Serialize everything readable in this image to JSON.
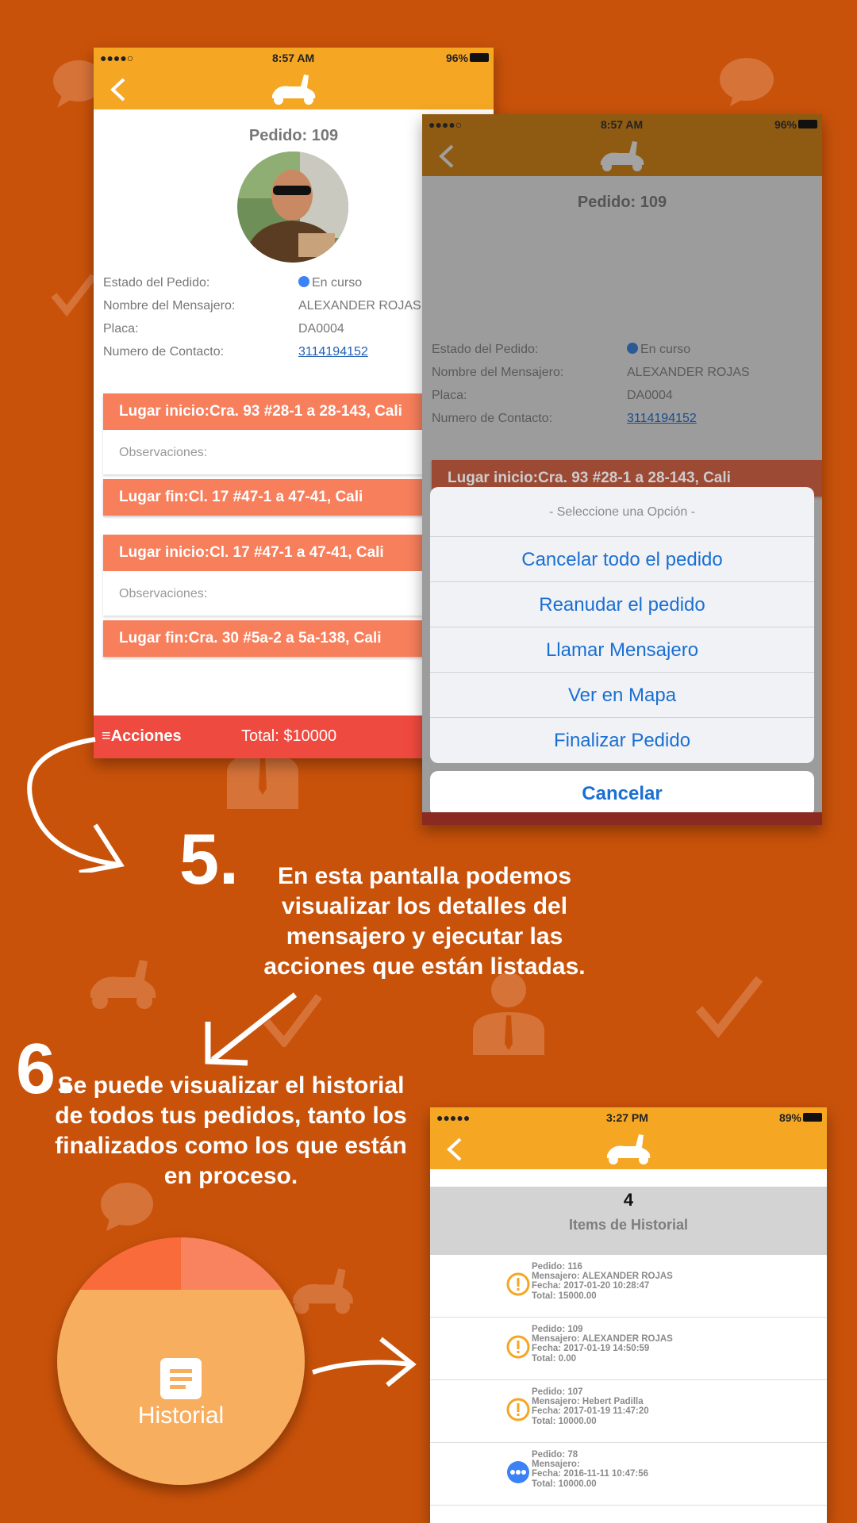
{
  "colors": {
    "background": "#c9520a",
    "accent": "#f5a623",
    "bar": "#f77f5c",
    "footer": "#ef4a3f",
    "actionBlue": "#1a6fd4",
    "historyCircle": "#f8ae5f"
  },
  "phone1": {
    "status": {
      "carrier": "●●●●○",
      "time": "8:57 AM",
      "battery": "96%"
    },
    "order_title": "Pedido: 109",
    "info": [
      {
        "key": "Estado del Pedido:",
        "value": "En curso"
      },
      {
        "key": "Nombre del Mensajero:",
        "value": "ALEXANDER ROJAS"
      },
      {
        "key": "Placa:",
        "value": "DA0004"
      },
      {
        "key": "Numero de Contacto:",
        "value": "3114194152"
      }
    ],
    "route1": {
      "start": "Lugar inicio:Cra. 93 #28-1 a 28-143, Cali",
      "obs": "Observaciones:",
      "end": "Lugar fin:Cl. 17 #47-1 a 47-41, Cali"
    },
    "route2": {
      "start": "Lugar inicio:Cl. 17 #47-1 a 47-41, Cali",
      "obs": "Observaciones:",
      "end": "Lugar fin:Cra. 30 #5a-2 a 5a-138, Cali"
    },
    "footer": {
      "actions": "≡Acciones",
      "total": "Total: $10000"
    }
  },
  "phone2": {
    "status": {
      "carrier": "●●●●○",
      "time": "8:57 AM",
      "battery": "96%"
    },
    "order_title": "Pedido: 109",
    "info": [
      {
        "key": "Estado del Pedido:",
        "value": "En curso"
      },
      {
        "key": "Nombre del Mensajero:",
        "value": "ALEXANDER ROJAS"
      },
      {
        "key": "Placa:",
        "value": "DA0004"
      },
      {
        "key": "Numero de Contacto:",
        "value": "3114194152"
      }
    ],
    "route_start": "Lugar inicio:Cra. 93 #28-1 a 28-143, Cali",
    "sheet": {
      "title": "- Seleccione una Opción -",
      "options": [
        "Cancelar todo el pedido",
        "Reanudar el pedido",
        "Llamar Mensajero",
        "Ver en Mapa",
        "Finalizar Pedido"
      ],
      "cancel": "Cancelar"
    }
  },
  "step5": {
    "number": "5.",
    "text": "En esta pantalla podemos visualizar los detalles del mensajero  y ejecutar las acciones que están listadas."
  },
  "step6": {
    "number": "6.",
    "text": "Se puede visualizar el historial de todos tus pedidos, tanto los finalizados como los que están en proceso."
  },
  "history_button": {
    "label": "Historial",
    "icon": "document-icon"
  },
  "phone3": {
    "status": {
      "carrier": "●●●●●",
      "time": "3:27 PM",
      "battery": "89%"
    },
    "count": "4",
    "subtitle": "Items de Historial",
    "items": [
      {
        "status": "pending",
        "line1": "Pedido: 116",
        "line2": "Mensajero: ALEXANDER ROJAS",
        "line3": "Fecha: 2017-01-20 10:28:47",
        "line4": "Total: 15000.00"
      },
      {
        "status": "pending",
        "line1": "Pedido: 109",
        "line2": "Mensajero: ALEXANDER ROJAS",
        "line3": "Fecha: 2017-01-19 14:50:59",
        "line4": "Total: 0.00"
      },
      {
        "status": "pending",
        "line1": "Pedido: 107",
        "line2": "Mensajero: Hebert Padilla",
        "line3": "Fecha: 2017-01-19 11:47:20",
        "line4": "Total: 10000.00"
      },
      {
        "status": "in-progress",
        "line1": "Pedido: 78",
        "line2": "Mensajero:",
        "line3": "Fecha: 2016-11-11 10:47:56",
        "line4": "Total: 10000.00"
      }
    ]
  }
}
